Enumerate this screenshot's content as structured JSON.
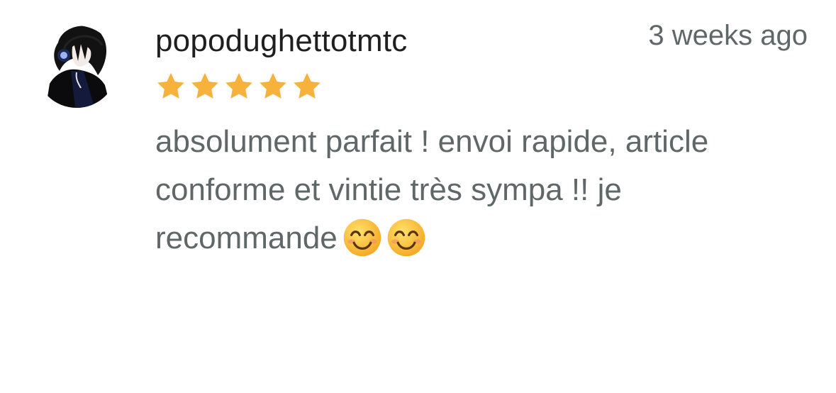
{
  "review": {
    "username": "popodughettotmtc",
    "timestamp": "3 weeks ago",
    "rating": 5,
    "rating_max": 5,
    "comment_text": "absolument parfait ! envoi rapide, article conforme et vintie très sympa !! je recommande",
    "comment_emojis": [
      "smiling-face-emoji",
      "smiling-face-emoji"
    ],
    "avatar_icon": "user-avatar-icon",
    "star_icon": "star-icon"
  },
  "colors": {
    "username": "#1f1f1f",
    "secondary_text": "#5f6769",
    "star": "#f7b23b",
    "background": "#ffffff"
  }
}
